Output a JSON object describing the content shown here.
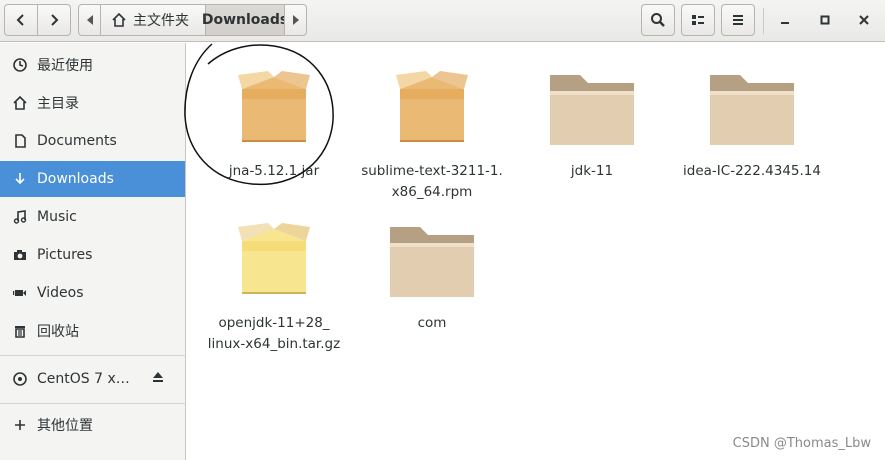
{
  "header": {
    "path_home_label": "主文件夹",
    "path_current_label": "Downloads"
  },
  "sidebar": {
    "items": [
      {
        "label": "最近使用",
        "icon": "clock-icon"
      },
      {
        "label": "主目录",
        "icon": "home-icon"
      },
      {
        "label": "Documents",
        "icon": "document-icon"
      },
      {
        "label": "Downloads",
        "icon": "download-icon",
        "active": true
      },
      {
        "label": "Music",
        "icon": "music-icon"
      },
      {
        "label": "Pictures",
        "icon": "camera-icon"
      },
      {
        "label": "Videos",
        "icon": "video-icon"
      },
      {
        "label": "回收站",
        "icon": "trash-icon"
      }
    ],
    "drive": {
      "label": "CentOS 7 x…",
      "icon": "disc-icon"
    },
    "other": {
      "label": "其他位置",
      "icon": "plus-icon"
    }
  },
  "files": [
    {
      "line1": "jna-5.12.1.jar",
      "line2": "",
      "type": "package"
    },
    {
      "line1": "sublime-text-3211-1.",
      "line2": "x86_64.rpm",
      "type": "package"
    },
    {
      "line1": "jdk-11",
      "line2": "",
      "type": "folder"
    },
    {
      "line1": "idea-IC-222.4345.14",
      "line2": "",
      "type": "folder"
    },
    {
      "line1": "openjdk-11+28_",
      "line2": "linux-x64_bin.tar.gz",
      "type": "archive"
    },
    {
      "line1": "com",
      "line2": "",
      "type": "folder"
    }
  ],
  "watermark": "CSDN @Thomas_Lbw",
  "colors": {
    "accent": "#4a90d9",
    "folder": "#d9c3a5",
    "package": "#eab973"
  }
}
